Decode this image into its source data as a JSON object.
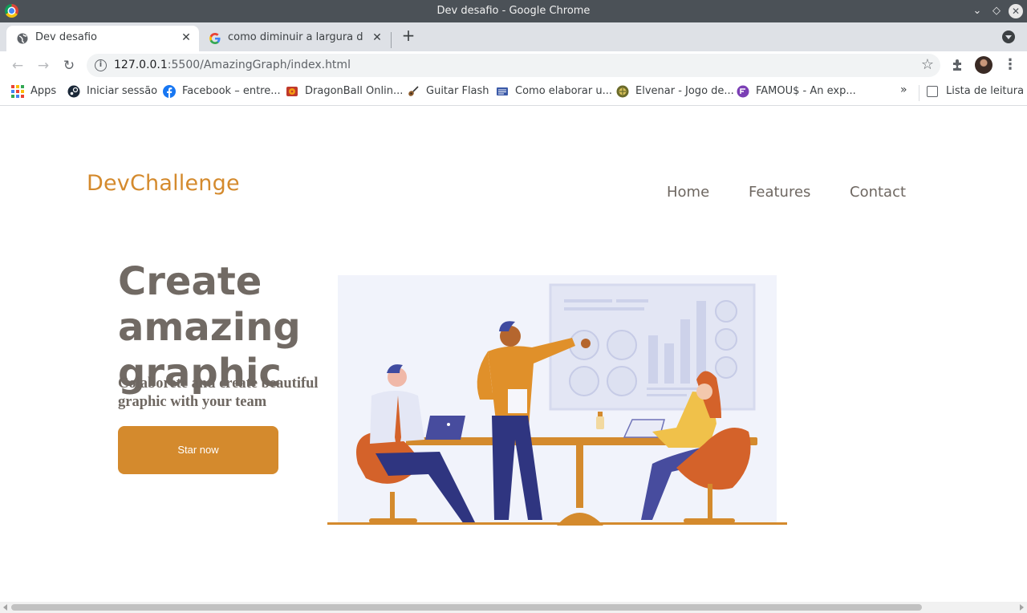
{
  "window": {
    "title": "Dev desafio - Google Chrome"
  },
  "tabs": [
    {
      "label": "Dev desafio",
      "active": true,
      "icon": "globe-icon"
    },
    {
      "label": "como diminuir a largura das l",
      "active": false,
      "icon": "google-icon"
    }
  ],
  "toolbar": {
    "url_host": "127.0.0.1",
    "url_path": ":5500/AmazingGraph/index.html"
  },
  "bookmarks": {
    "items": [
      {
        "label": "Apps",
        "icon": "apps-grid-icon"
      },
      {
        "label": "Iniciar sessão",
        "icon": "steam-icon"
      },
      {
        "label": "Facebook – entre...",
        "icon": "facebook-icon"
      },
      {
        "label": "DragonBall Onlin...",
        "icon": "dragonball-icon"
      },
      {
        "label": "Guitar Flash",
        "icon": "guitar-icon"
      },
      {
        "label": "Como elaborar u...",
        "icon": "doc-icon"
      },
      {
        "label": "Elvenar - Jogo de...",
        "icon": "elvenar-icon"
      },
      {
        "label": "FAMOU$ - An exp...",
        "icon": "famous-icon"
      }
    ],
    "more": "»",
    "reading_list": "Lista de leitura"
  },
  "page": {
    "logo": "DevChallenge",
    "nav": [
      "Home",
      "Features",
      "Contact"
    ],
    "hero_title": "Create amazing graphic",
    "hero_subtitle": "Colaborete and create beautiful graphic with your team",
    "cta_label": "Star now"
  },
  "colors": {
    "accent": "#d48a2d",
    "heading": "#716a64",
    "nav_text": "#6e6761"
  }
}
